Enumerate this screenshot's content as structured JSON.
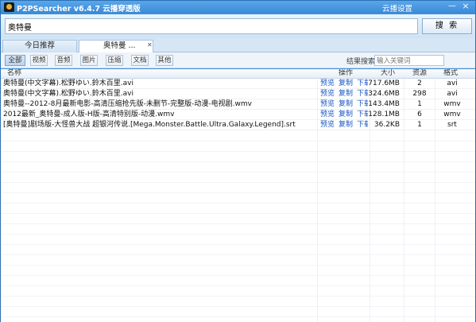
{
  "window": {
    "title": "P2PSearcher v6.4.7 云播穿透版",
    "cloud_settings": "云播设置",
    "minimize": "—",
    "close": "×"
  },
  "search": {
    "value": "奥特曼",
    "button": "搜 索"
  },
  "tabs": [
    {
      "label": "今日推荐"
    },
    {
      "label": "奥特曼 ..."
    }
  ],
  "filters": [
    "全部",
    "视频",
    "音频",
    "图片",
    "压缩",
    "文档",
    "其他"
  ],
  "result_search": {
    "label": "结果搜索:",
    "placeholder": "输入关键词"
  },
  "table": {
    "columns": {
      "name": "名称",
      "ops": "操作",
      "size": "大小",
      "sources": "资源",
      "format": "格式"
    },
    "op_labels": {
      "preview": "预览",
      "copy": "复制",
      "download": "下载"
    },
    "rows": [
      {
        "name": "奥特曼(中文字幕).松野ゆい.鈴木百里.avi",
        "size": "717.6MB",
        "sources": "2",
        "format": "avi"
      },
      {
        "name": "奥特曼(中文字幕).松野ゆい.鈴木百里.avi",
        "size": "324.6MB",
        "sources": "298",
        "format": "avi"
      },
      {
        "name": "奥特曼--2012-8月最新电影-高清压缩抢先版-未删节-完整版-动漫-电视剧.wmv",
        "size": "143.4MB",
        "sources": "1",
        "format": "wmv"
      },
      {
        "name": "2012最新_奥特曼-成人版-H版-高清特别版-动漫.wmv",
        "size": "128.1MB",
        "sources": "6",
        "format": "wmv"
      },
      {
        "name": "[奥特曼]剧场版-大怪兽大战 超银河传说.[Mega.Monster.Battle.Ultra.Galaxy.Legend].srt",
        "size": "36.2KB",
        "sources": "1",
        "format": "srt"
      }
    ]
  }
}
